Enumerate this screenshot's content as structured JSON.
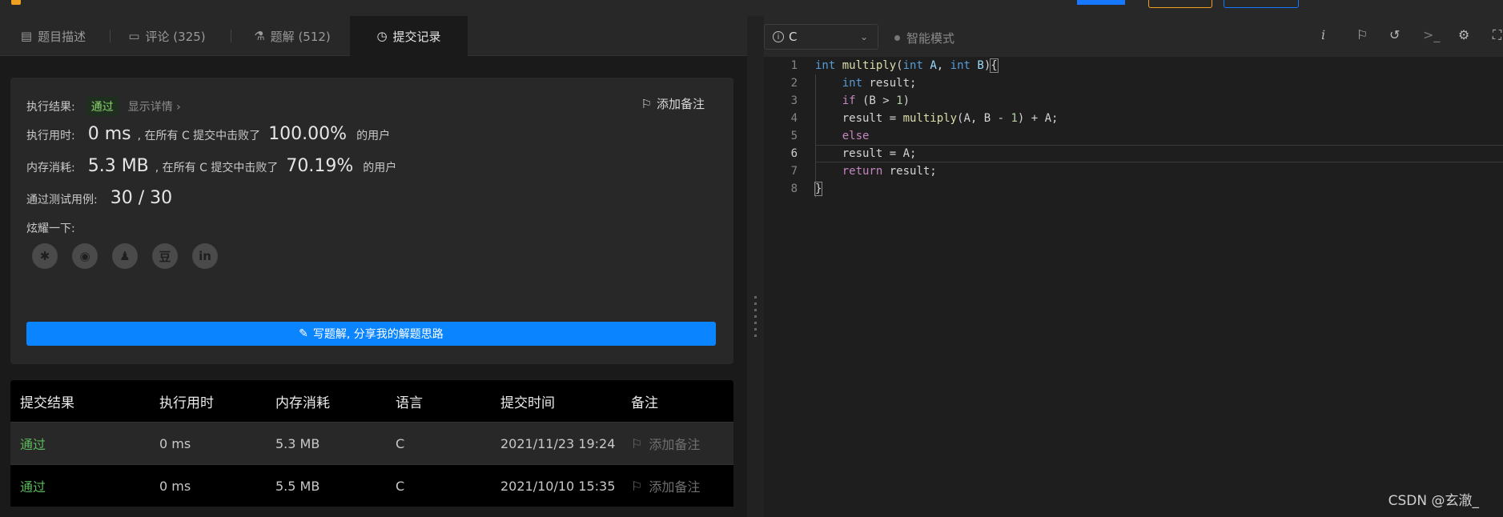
{
  "tabs": [
    {
      "label": "题目描述",
      "icon": "description-icon"
    },
    {
      "label": "评论 (325)",
      "icon": "comment-icon"
    },
    {
      "label": "题解 (512)",
      "icon": "flask-icon"
    },
    {
      "label": "提交记录",
      "icon": "clock-icon"
    }
  ],
  "result": {
    "exec_result_label": "执行结果:",
    "status": "通过",
    "show_detail": "显示详情 ›",
    "add_note": "添加备注",
    "time_label": "执行用时:",
    "time_value": "0 ms",
    "time_beat_text": ", 在所有 C 提交中击败了",
    "time_beat_pct": "100.00%",
    "time_users": "的用户",
    "mem_label": "内存消耗:",
    "mem_value": "5.3 MB",
    "mem_beat_text": ", 在所有 C 提交中击败了",
    "mem_beat_pct": "70.19%",
    "mem_users": "的用户",
    "tests_label": "通过测试用例:",
    "tests_value": "30 / 30",
    "share_label": "炫耀一下:",
    "write_solution": "写题解, 分享我的解题思路"
  },
  "submissions": {
    "headers": [
      "提交结果",
      "执行用时",
      "内存消耗",
      "语言",
      "提交时间",
      "备注"
    ],
    "rows": [
      {
        "status": "通过",
        "time": "0 ms",
        "memory": "5.3 MB",
        "lang": "C",
        "submitted": "2021/11/23 19:24",
        "note": "添加备注"
      },
      {
        "status": "通过",
        "time": "0 ms",
        "memory": "5.5 MB",
        "lang": "C",
        "submitted": "2021/10/10 15:35",
        "note": "添加备注"
      }
    ]
  },
  "editor": {
    "language": "C",
    "smart_mode": "智能模式",
    "current_line": 6
  },
  "watermark": "CSDN @玄澈_",
  "colors": {
    "accent": "#0a84ff",
    "success": "#5cb85c"
  }
}
